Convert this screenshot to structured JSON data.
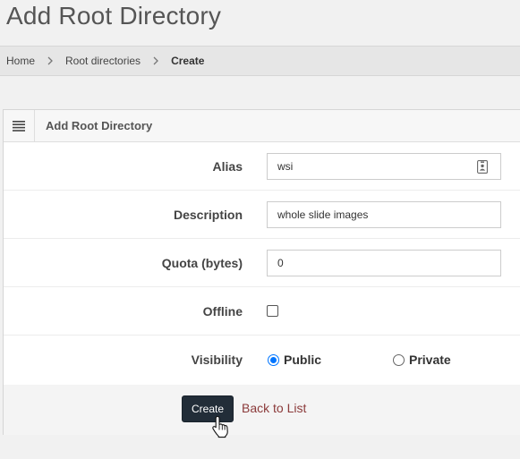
{
  "page": {
    "title": "Add Root Directory"
  },
  "breadcrumb": {
    "items": [
      {
        "label": "Home"
      },
      {
        "label": "Root directories"
      },
      {
        "label": "Create"
      }
    ]
  },
  "panel": {
    "title": "Add Root Directory",
    "menu_icon": "hamburger-list-icon"
  },
  "form": {
    "alias": {
      "label": "Alias",
      "value": "wsi",
      "icon": "contact-card-icon"
    },
    "description": {
      "label": "Description",
      "value": "whole slide images"
    },
    "quota": {
      "label": "Quota (bytes)",
      "value": "0"
    },
    "offline": {
      "label": "Offline",
      "checked": false
    },
    "visibility": {
      "label": "Visibility",
      "options": [
        {
          "label": "Public",
          "selected": true
        },
        {
          "label": "Private",
          "selected": false
        }
      ]
    }
  },
  "actions": {
    "create_label": "Create",
    "back_label": "Back to List"
  },
  "colors": {
    "button_bg": "#222d38",
    "link": "#8b3a3a",
    "radio_accent": "#0075ff"
  }
}
